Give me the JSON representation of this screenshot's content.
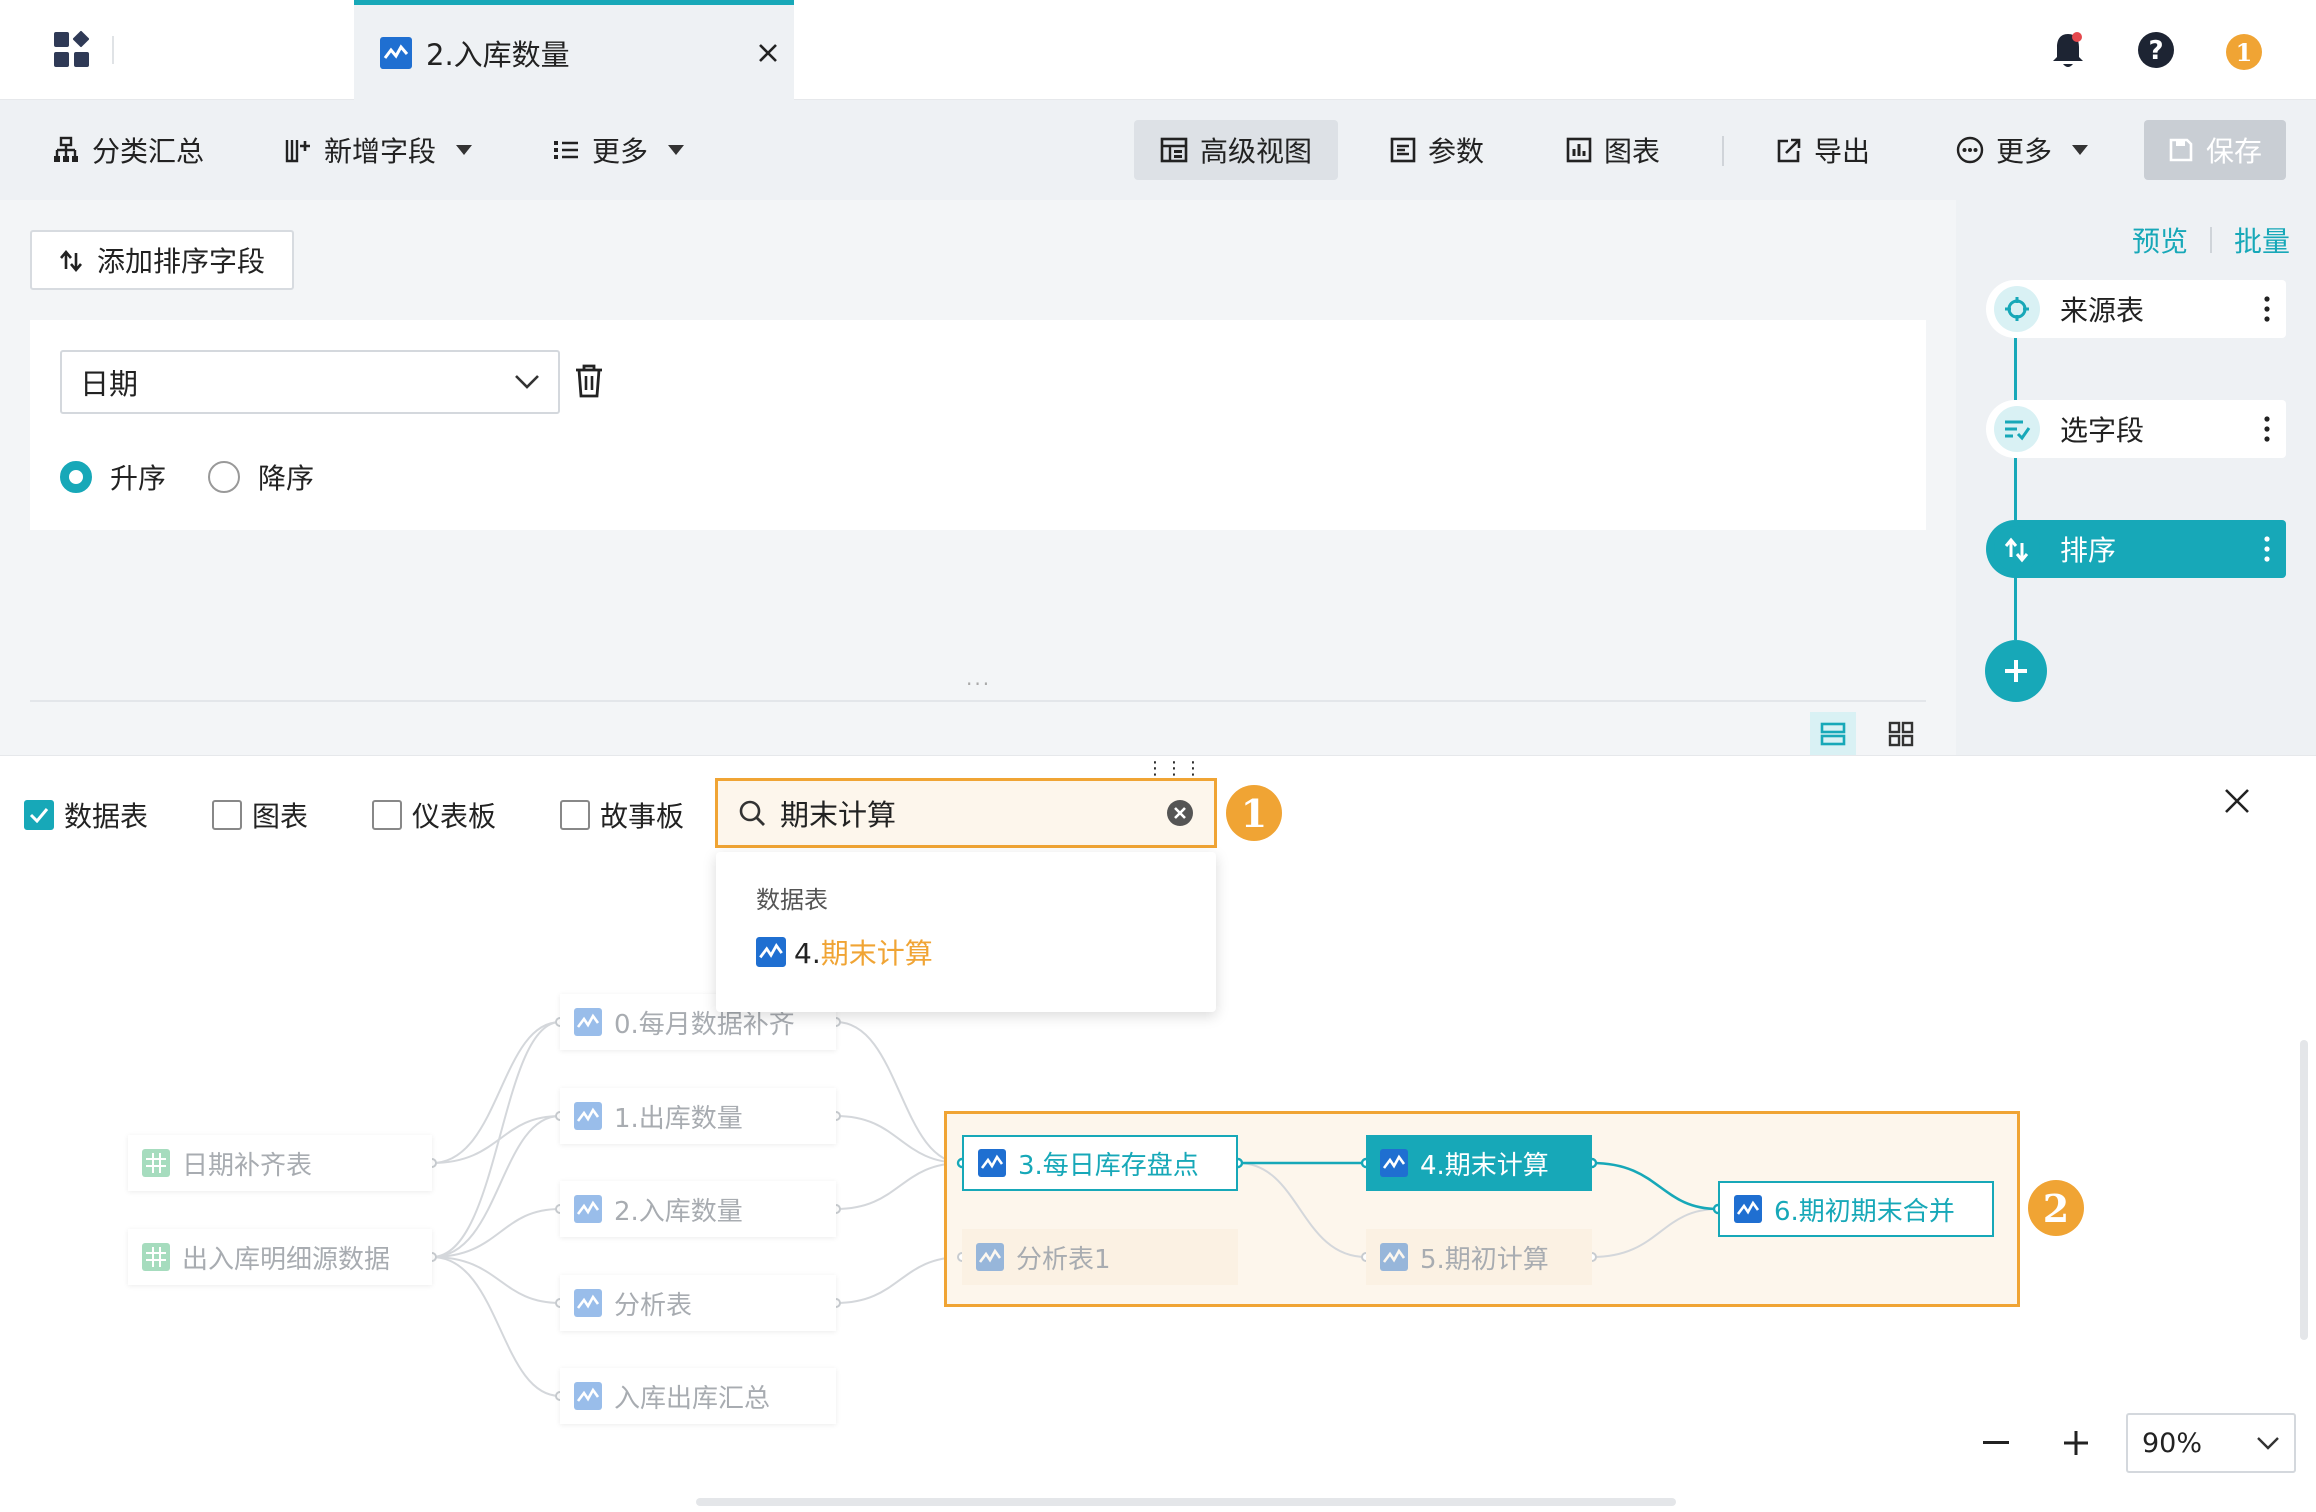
{
  "tabbar": {
    "tab_title": "2.入库数量",
    "notification_badge": "1"
  },
  "toolbar": {
    "category_summary": "分类汇总",
    "add_field": "新增字段",
    "more_left": "更多",
    "advanced_view": "高级视图",
    "params": "参数",
    "chart": "图表",
    "export": "导出",
    "more_right": "更多",
    "save": "保存"
  },
  "sort_editor": {
    "add_sort_field": "添加排序字段",
    "field_value": "日期",
    "asc": "升序",
    "desc": "降序",
    "selected_order": "升序"
  },
  "steps_panel": {
    "preview": "预览",
    "batch": "批量",
    "steps": [
      {
        "label": "来源表",
        "active": false
      },
      {
        "label": "选字段",
        "active": false
      },
      {
        "label": "排序",
        "active": true
      }
    ]
  },
  "lineage": {
    "filters": [
      {
        "label": "数据表",
        "checked": true
      },
      {
        "label": "图表",
        "checked": false
      },
      {
        "label": "仪表板",
        "checked": false
      },
      {
        "label": "故事板",
        "checked": false
      }
    ],
    "search_value": "期末计算",
    "callout_1": "1",
    "callout_2": "2",
    "dropdown": {
      "group": "数据表",
      "item_prefix": "4.",
      "item_match": "期末计算"
    },
    "nodes": {
      "date_fill": "日期补齐表",
      "source_detail": "出入库明细源数据",
      "monthly_fill": "0.每月数据补齐",
      "outbound_qty": "1.出库数量",
      "inbound_qty": "2.入库数量",
      "analysis": "分析表",
      "in_out_summary": "入库出库汇总",
      "daily_stock": "3.每日库存盘点",
      "analysis_1": "分析表1",
      "period_end": "4.期末计算",
      "period_begin": "5.期初计算",
      "merge": "6.期初期末合并"
    },
    "zoom": "90%"
  },
  "colors": {
    "accent": "#17a8b8",
    "highlight": "#f0a434",
    "toolbar_bg": "#eef1f4"
  }
}
